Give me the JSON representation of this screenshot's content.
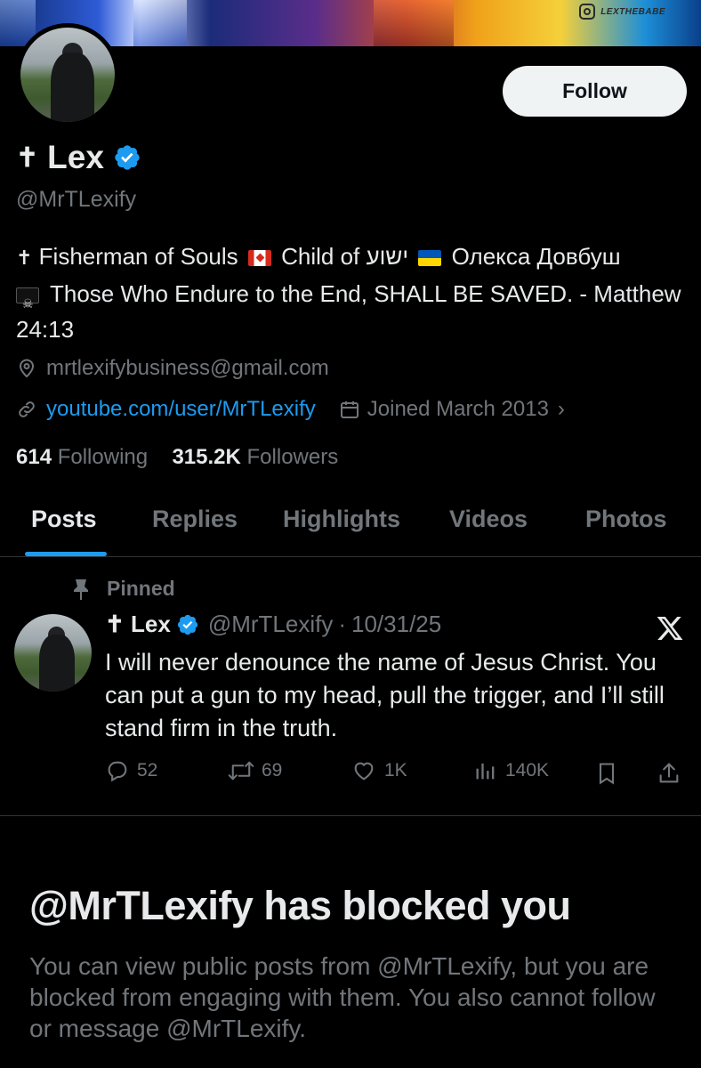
{
  "banner": {
    "watermark": "LEXTHEBABE"
  },
  "profile": {
    "name_prefix": "✝",
    "name": "Lex",
    "handle": "@MrTLexify",
    "follow_label": "Follow",
    "bio": {
      "prefix": "✝",
      "part1": "Fisherman of Souls",
      "part2": "Child of ישוע",
      "part3": "Олекса Довбуш",
      "line2": "Those Who Endure to the End, SHALL BE SAVED. - Matthew 24:13"
    },
    "email": "mrtlexifybusiness@gmail.com",
    "website": "youtube.com/user/MrTLexify",
    "joined": "Joined March 2013",
    "following_count": "614",
    "following_label": "Following",
    "followers_count": "315.2K",
    "followers_label": "Followers"
  },
  "tabs": [
    {
      "label": "Posts",
      "active": true
    },
    {
      "label": "Replies"
    },
    {
      "label": "Highlights"
    },
    {
      "label": "Videos"
    },
    {
      "label": "Photos"
    }
  ],
  "pinned_tweet": {
    "pinned_label": "Pinned",
    "author_name": "✝ Lex",
    "author_handle": "@MrTLexify",
    "separator": "·",
    "date": "10/31/25",
    "text": "I will never denounce the name of Jesus Christ. You can put a gun to my head, pull the trigger, and I’ll still stand firm in the truth.",
    "replies": "52",
    "retweets": "69",
    "likes": "1K",
    "views": "140K"
  },
  "blocked": {
    "title": "@MrTLexify has blocked you",
    "description": "You can view public posts from @MrTLexify, but you are blocked from engaging with them. You also cannot follow or message @MrTLexify."
  },
  "colors": {
    "accent": "#1d9bf0",
    "muted": "#71767b",
    "text": "#e7e9ea",
    "background": "#000000"
  }
}
